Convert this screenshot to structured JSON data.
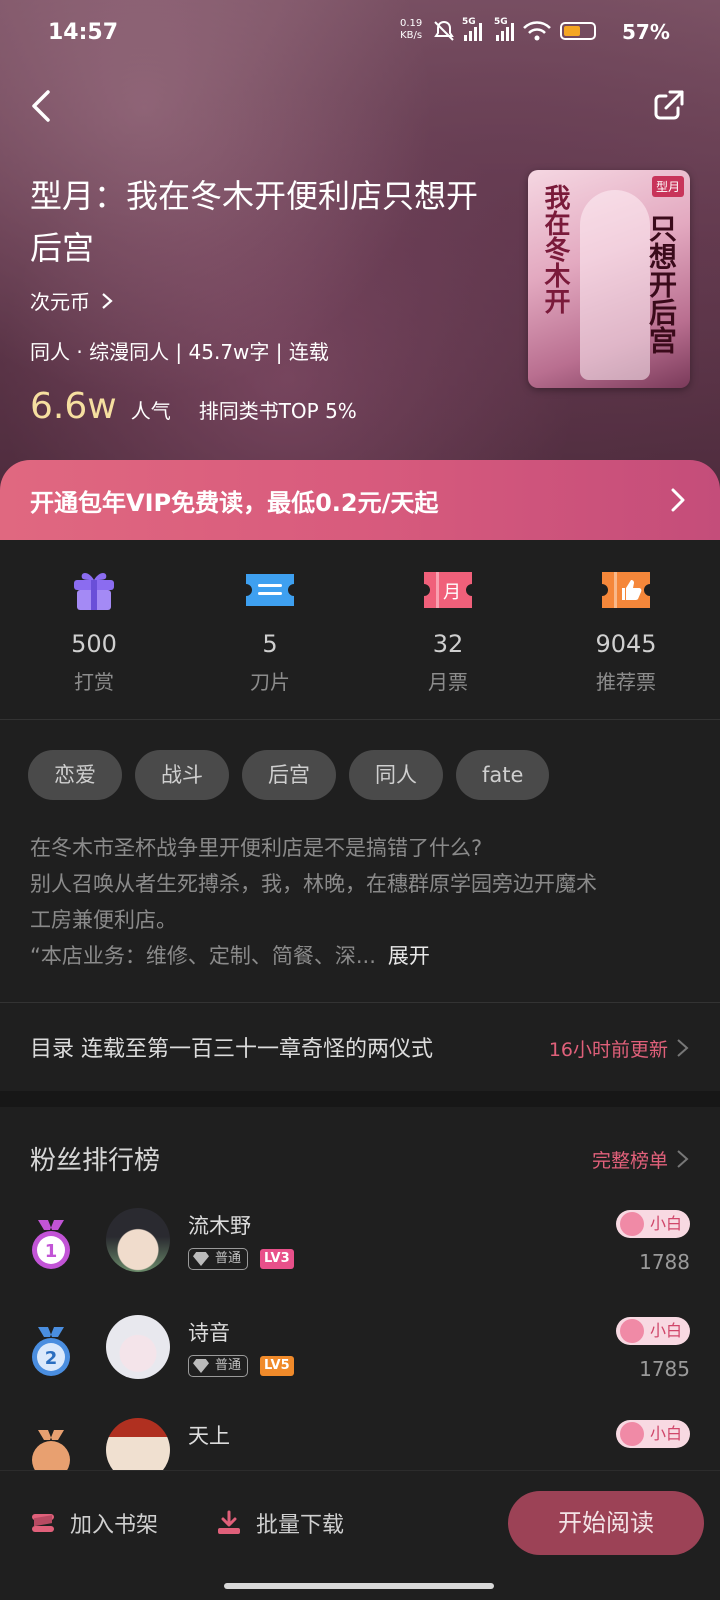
{
  "status_bar": {
    "time": "14:57",
    "speed_value": "0.19",
    "speed_unit": "KB/s",
    "network_1": "5G",
    "network_2": "5G",
    "battery_percent": "57%",
    "battery_level": 0.57
  },
  "book": {
    "title": "型月：我在冬木开便利店只想开后宫",
    "author": "次元币",
    "meta": "同人 · 综漫同人 | 45.7w字 | 连载",
    "popularity_value": "6.6w",
    "popularity_label": "人气",
    "rank_text": "排同类书TOP 5%",
    "cover": {
      "left_text": "我在冬木开",
      "right_text": "只想开后宫",
      "tag": "型月"
    }
  },
  "vip_banner": {
    "text": "开通包年VIP免费读，最低0.2元/天起"
  },
  "stats": [
    {
      "icon": "gift-icon",
      "value": "500",
      "label": "打赏",
      "color": "#8b6cf0"
    },
    {
      "icon": "ticket-blade-icon",
      "value": "5",
      "label": "刀片",
      "color": "#3ea0f0"
    },
    {
      "icon": "monthly-ticket-icon",
      "value": "32",
      "label": "月票",
      "color": "#f0607a",
      "glyph": "月"
    },
    {
      "icon": "recommend-ticket-icon",
      "value": "9045",
      "label": "推荐票",
      "color": "#f5873a"
    }
  ],
  "tags": [
    "恋爱",
    "战斗",
    "后宫",
    "同人",
    "fate"
  ],
  "description": {
    "line1": "在冬木市圣杯战争里开便利店是不是搞错了什么?",
    "line2": "别人召唤从者生死搏杀，我，林晚，在穗群原学园旁边开魔术",
    "line3": "工房兼便利店。",
    "line4": "“本店业务：维修、定制、简餐、深...",
    "expand": "展开"
  },
  "toc": {
    "text": "目录 连载至第一百三十一章奇怪的两仪式",
    "update": "16小时前更新"
  },
  "fans": {
    "title": "粉丝排行榜",
    "more": "完整榜单",
    "list": [
      {
        "rank": "1",
        "name": "流木野",
        "badge": "普通",
        "level": "LV3",
        "level_color": "#e8508a",
        "tag": "小白",
        "score": "1788",
        "medal_color": "#c254d6"
      },
      {
        "rank": "2",
        "name": "诗音",
        "badge": "普通",
        "level": "LV5",
        "level_color": "#f08a2a",
        "tag": "小白",
        "score": "1785",
        "medal_color": "#4a8ee0"
      },
      {
        "rank": "3",
        "name": "天上",
        "badge": "",
        "level": "",
        "level_color": "",
        "tag": "小白",
        "score": "",
        "medal_color": "#e8a070"
      }
    ]
  },
  "bottom_bar": {
    "add_shelf": "加入书架",
    "batch_download": "批量下载",
    "start_reading": "开始阅读"
  }
}
